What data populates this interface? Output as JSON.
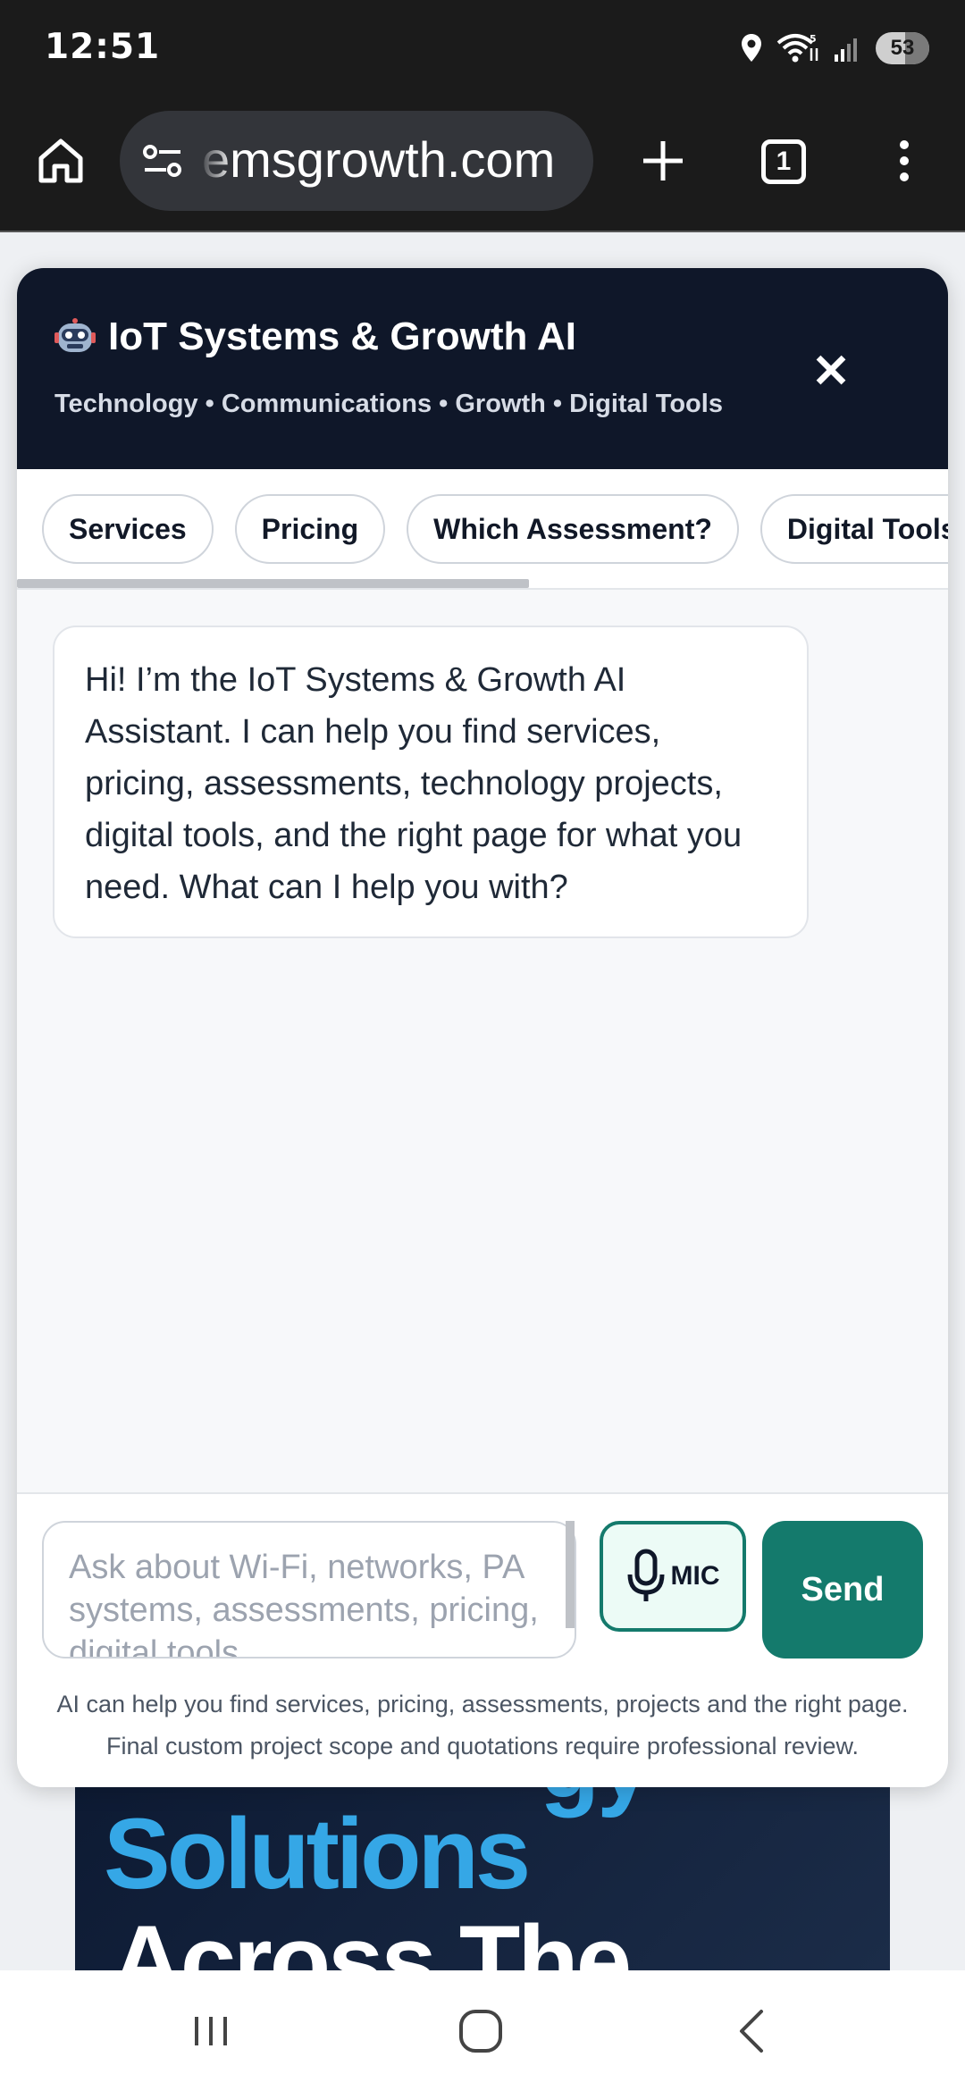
{
  "status_bar": {
    "time": "12:51",
    "battery": "53",
    "icons": [
      "location-icon",
      "wifi-icon",
      "signal-icon",
      "battery-icon"
    ]
  },
  "browser": {
    "url": "emsgrowth.com",
    "tab_count": "1",
    "icons": [
      "home-icon",
      "site-settings-icon",
      "new-tab-icon",
      "tabs-icon",
      "more-menu-icon"
    ]
  },
  "chat": {
    "title": "IoT Systems & Growth AI",
    "subtitle": "Technology • Communications • Growth • Digital Tools",
    "close_label": "✕",
    "quick_actions": [
      "Services",
      "Pricing",
      "Which Assessment?",
      "Digital Tools"
    ],
    "welcome_message": "Hi! I’m the IoT Systems & Growth AI Assistant. I can help you find services, pricing, assessments, technology projects, digital tools, and the right page for what you need. What can I help you with?",
    "input_placeholder": "Ask about Wi-Fi, networks, PA systems, assessments, pricing, digital tools...",
    "mic_label": "MIC",
    "send_label": "Send",
    "disclaimer_line1": "AI can help you find services, pricing, assessments, projects and the right page.",
    "disclaimer_line2": "Final custom project scope and quotations require professional review.",
    "colors": {
      "header_bg": "#0f1729",
      "accent": "#147a6c",
      "mic_bg": "#ecfbf6"
    }
  },
  "background_page": {
    "hero_line1": "gy",
    "hero_line2": "Solutions",
    "hero_line3": "Across The"
  },
  "nav_bar": {
    "icons": [
      "recent-apps-icon",
      "home-nav-icon",
      "back-icon"
    ]
  }
}
